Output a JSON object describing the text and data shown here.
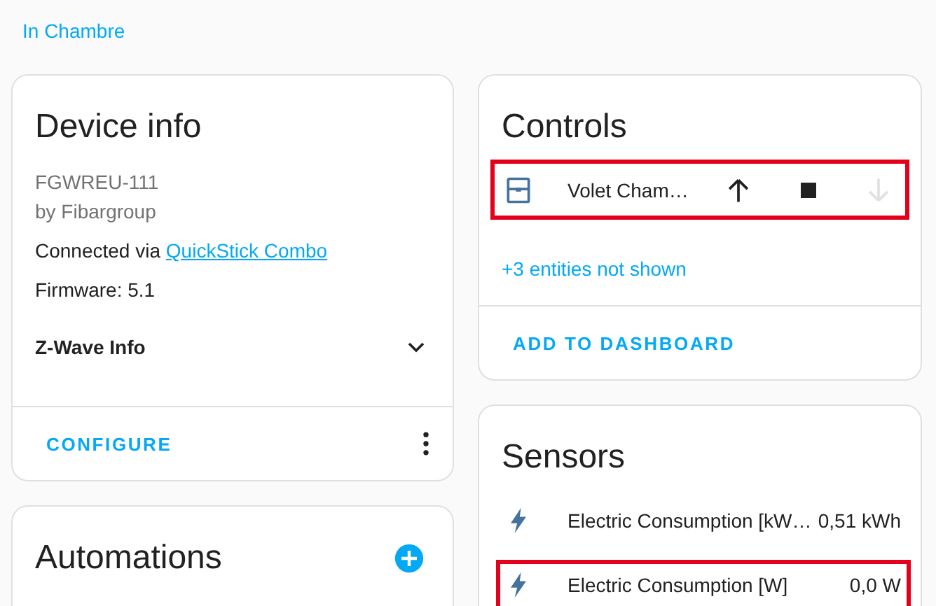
{
  "breadcrumb": "In Chambre",
  "device_info": {
    "title": "Device info",
    "model": "FGWREU-111",
    "manufacturer": "by Fibargroup",
    "connected_via": "Connected via",
    "connected_link": "QuickStick Combo",
    "firmware": "Firmware: 5.1",
    "expander": {
      "label": "Z-Wave Info",
      "expanded": false
    },
    "action": "CONFIGURE"
  },
  "automations": {
    "title": "Automations"
  },
  "controls": {
    "title": "Controls",
    "entities": [
      {
        "name": "Volet Cham…",
        "highlighted": true,
        "buttons": [
          {
            "kind": "up",
            "disabled": false
          },
          {
            "kind": "stop",
            "disabled": false
          },
          {
            "kind": "down",
            "disabled": true
          }
        ]
      }
    ],
    "more": "+3 entities not shown",
    "action": "ADD TO DASHBOARD"
  },
  "sensors": {
    "title": "Sensors",
    "entities": [
      {
        "name": "Electric Consumption [kW…",
        "value": "0,51 kWh",
        "highlighted": false
      },
      {
        "name": "Electric Consumption [W]",
        "value": "0,0 W",
        "highlighted": true
      }
    ]
  }
}
